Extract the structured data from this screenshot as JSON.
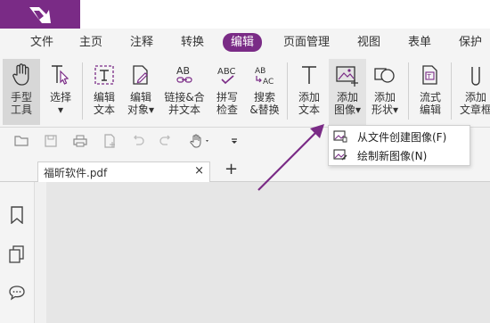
{
  "menu": {
    "tabs": [
      {
        "label": "文件"
      },
      {
        "label": "主页"
      },
      {
        "label": "注释"
      },
      {
        "label": "转换"
      },
      {
        "label": "编辑"
      },
      {
        "label": "页面管理"
      },
      {
        "label": "视图"
      },
      {
        "label": "表单"
      },
      {
        "label": "保护"
      }
    ],
    "active_tab": "编辑"
  },
  "ribbon": {
    "tools": [
      {
        "line1": "手型",
        "line2": "工具",
        "icon": "hand-icon"
      },
      {
        "line1": "选择",
        "line2": "▾",
        "icon": "select-cursor-icon"
      },
      {
        "line1": "编辑",
        "line2": "文本",
        "icon": "edit-text-icon"
      },
      {
        "line1": "编辑",
        "line2": "对象▾",
        "icon": "edit-object-icon"
      },
      {
        "line1": "链接&合",
        "line2": "并文本",
        "icon": "link-merge-text-icon"
      },
      {
        "line1": "拼写",
        "line2": "检查",
        "icon": "spell-check-icon"
      },
      {
        "line1": "搜索",
        "line2": "&替换",
        "icon": "search-replace-icon"
      },
      {
        "line1": "添加",
        "line2": "文本",
        "icon": "add-text-icon"
      },
      {
        "line1": "添加",
        "line2": "图像▾",
        "icon": "add-image-icon"
      },
      {
        "line1": "添加",
        "line2": "形状▾",
        "icon": "add-shape-icon"
      },
      {
        "line1": "流式",
        "line2": "编辑",
        "icon": "flow-edit-icon"
      },
      {
        "line1": "添加",
        "line2": "文章框",
        "icon": "add-article-icon"
      }
    ]
  },
  "document": {
    "tab_name": "福昕软件.pdf",
    "close_glyph": "×",
    "add_glyph": "+"
  },
  "dropdown": {
    "items": [
      {
        "label": "从文件创建图像(F)",
        "icon": "image-from-file-icon"
      },
      {
        "label": "绘制新图像(N)",
        "icon": "draw-new-image-icon"
      }
    ]
  },
  "colors": {
    "brand": "#7a2b86",
    "arrow": "#7a2b86"
  }
}
